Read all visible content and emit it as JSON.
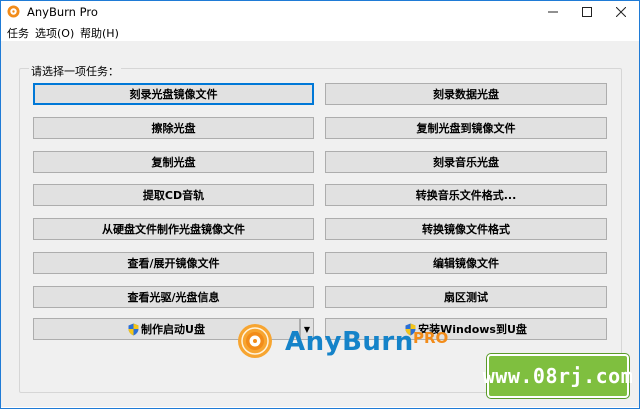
{
  "window": {
    "title": "AnyBurn Pro"
  },
  "menu": [
    "任务",
    "选项(O)",
    "帮助(H)"
  ],
  "group_label": "请选择一项任务：",
  "buttons": {
    "burn_image": "刻录光盘镜像文件",
    "burn_data": "刻录数据光盘",
    "erase": "擦除光盘",
    "copy_to_image": "复制光盘到镜像文件",
    "copy_disc": "复制光盘",
    "burn_audio": "刻录音乐光盘",
    "rip_cd": "提取CD音轨",
    "convert_audio": "转换音乐文件格式...",
    "make_image_from_files": "从硬盘文件制作光盘镜像文件",
    "convert_image": "转换镜像文件格式",
    "browse_image": "查看/展开镜像文件",
    "edit_image": "编辑镜像文件",
    "drive_info": "查看光驱/光盘信息",
    "sector_test": "扇区测试",
    "make_bootable_usb": "制作启动U盘",
    "install_windows_usb": "安装Windows到U盘"
  },
  "logo": {
    "name": "AnyBurn",
    "edition": "PRO"
  },
  "watermark": "www.08rj.com",
  "colors": {
    "accent": "#0078d7",
    "logo_blue": "#1583c9",
    "logo_orange": "#f28c1a",
    "watermark_green": "#7fbf3f"
  }
}
